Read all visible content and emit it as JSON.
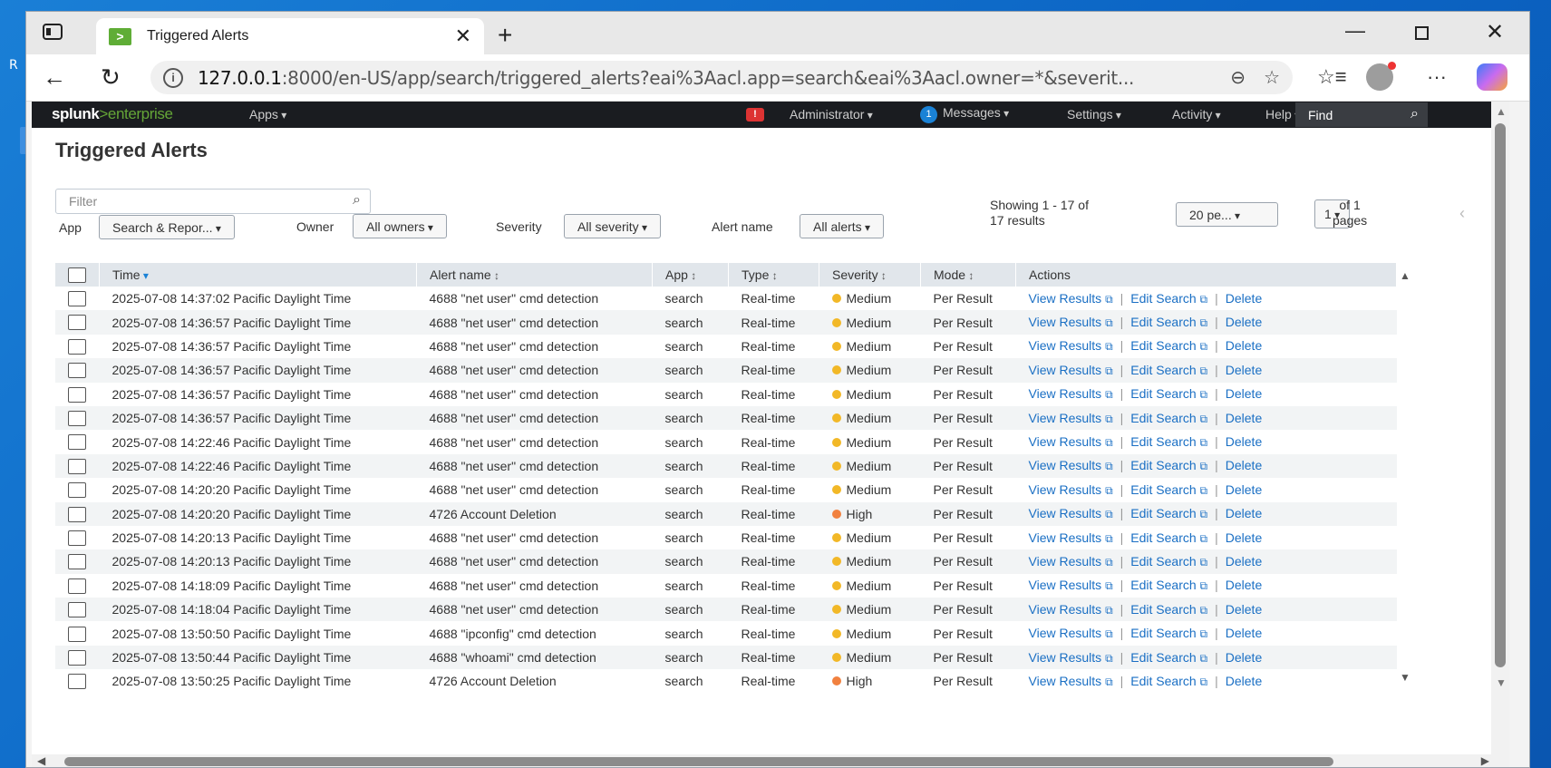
{
  "browser": {
    "tab_title": "Triggered Alerts",
    "tab_favicon": ">",
    "url_host": "127.0.0.1",
    "url_rest": ":8000/en-US/app/search/triggered_alerts?eai%3Aacl.app=search&eai%3Aacl.owner=*&severit..."
  },
  "navbar": {
    "logo_main": "splunk",
    "logo_sub": ">enterprise",
    "apps": "Apps",
    "admin": "Administrator",
    "messages_count": "1",
    "messages": "Messages",
    "settings": "Settings",
    "activity": "Activity",
    "help": "Help",
    "find": "Find"
  },
  "page": {
    "title": "Triggered Alerts",
    "filter_placeholder": "Filter",
    "app_label": "App",
    "app_value": "Search & Repor...",
    "owner_label": "Owner",
    "owner_value": "All owners",
    "severity_label": "Severity",
    "severity_value": "All severity",
    "alertname_label": "Alert name",
    "alertname_value": "All alerts",
    "showing_line1": "Showing 1 - 17 of",
    "showing_line2": "17 results",
    "per_page": "20 pe...",
    "page_num": "1",
    "of_pages_1": "of 1",
    "of_pages_2": "pages"
  },
  "columns": {
    "time": "Time",
    "alert_name": "Alert name",
    "app": "App",
    "type": "Type",
    "severity": "Severity",
    "mode": "Mode",
    "actions": "Actions"
  },
  "actions": {
    "view": "View Results",
    "edit": "Edit Search",
    "delete": "Delete"
  },
  "severity_colors": {
    "Medium": "#f2b827",
    "High": "#f1813f"
  },
  "rows": [
    {
      "time": "2025-07-08 14:37:02 Pacific Daylight Time",
      "name": "4688 \"net user\" cmd detection",
      "app": "search",
      "type": "Real-time",
      "severity": "Medium",
      "mode": "Per Result"
    },
    {
      "time": "2025-07-08 14:36:57 Pacific Daylight Time",
      "name": "4688 \"net user\" cmd detection",
      "app": "search",
      "type": "Real-time",
      "severity": "Medium",
      "mode": "Per Result"
    },
    {
      "time": "2025-07-08 14:36:57 Pacific Daylight Time",
      "name": "4688 \"net user\" cmd detection",
      "app": "search",
      "type": "Real-time",
      "severity": "Medium",
      "mode": "Per Result"
    },
    {
      "time": "2025-07-08 14:36:57 Pacific Daylight Time",
      "name": "4688 \"net user\" cmd detection",
      "app": "search",
      "type": "Real-time",
      "severity": "Medium",
      "mode": "Per Result"
    },
    {
      "time": "2025-07-08 14:36:57 Pacific Daylight Time",
      "name": "4688 \"net user\" cmd detection",
      "app": "search",
      "type": "Real-time",
      "severity": "Medium",
      "mode": "Per Result"
    },
    {
      "time": "2025-07-08 14:36:57 Pacific Daylight Time",
      "name": "4688 \"net user\" cmd detection",
      "app": "search",
      "type": "Real-time",
      "severity": "Medium",
      "mode": "Per Result"
    },
    {
      "time": "2025-07-08 14:22:46 Pacific Daylight Time",
      "name": "4688 \"net user\" cmd detection",
      "app": "search",
      "type": "Real-time",
      "severity": "Medium",
      "mode": "Per Result"
    },
    {
      "time": "2025-07-08 14:22:46 Pacific Daylight Time",
      "name": "4688 \"net user\" cmd detection",
      "app": "search",
      "type": "Real-time",
      "severity": "Medium",
      "mode": "Per Result"
    },
    {
      "time": "2025-07-08 14:20:20 Pacific Daylight Time",
      "name": "4688 \"net user\" cmd detection",
      "app": "search",
      "type": "Real-time",
      "severity": "Medium",
      "mode": "Per Result"
    },
    {
      "time": "2025-07-08 14:20:20 Pacific Daylight Time",
      "name": "4726 Account Deletion",
      "app": "search",
      "type": "Real-time",
      "severity": "High",
      "mode": "Per Result"
    },
    {
      "time": "2025-07-08 14:20:13 Pacific Daylight Time",
      "name": "4688 \"net user\" cmd detection",
      "app": "search",
      "type": "Real-time",
      "severity": "Medium",
      "mode": "Per Result"
    },
    {
      "time": "2025-07-08 14:20:13 Pacific Daylight Time",
      "name": "4688 \"net user\" cmd detection",
      "app": "search",
      "type": "Real-time",
      "severity": "Medium",
      "mode": "Per Result"
    },
    {
      "time": "2025-07-08 14:18:09 Pacific Daylight Time",
      "name": "4688 \"net user\" cmd detection",
      "app": "search",
      "type": "Real-time",
      "severity": "Medium",
      "mode": "Per Result"
    },
    {
      "time": "2025-07-08 14:18:04 Pacific Daylight Time",
      "name": "4688 \"net user\" cmd detection",
      "app": "search",
      "type": "Real-time",
      "severity": "Medium",
      "mode": "Per Result"
    },
    {
      "time": "2025-07-08 13:50:50 Pacific Daylight Time",
      "name": "4688 \"ipconfig\" cmd detection",
      "app": "search",
      "type": "Real-time",
      "severity": "Medium",
      "mode": "Per Result"
    },
    {
      "time": "2025-07-08 13:50:44 Pacific Daylight Time",
      "name": "4688 \"whoami\" cmd detection",
      "app": "search",
      "type": "Real-time",
      "severity": "Medium",
      "mode": "Per Result"
    },
    {
      "time": "2025-07-08 13:50:25 Pacific Daylight Time",
      "name": "4726 Account Deletion",
      "app": "search",
      "type": "Real-time",
      "severity": "High",
      "mode": "Per Result"
    }
  ]
}
